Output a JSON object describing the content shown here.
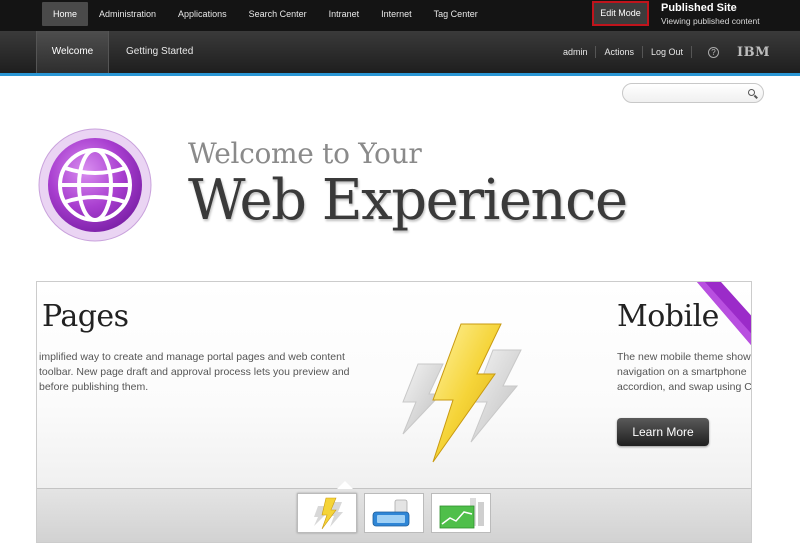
{
  "topnav": {
    "items": [
      "Home",
      "Administration",
      "Applications",
      "Search Center",
      "Intranet",
      "Internet",
      "Tag Center"
    ],
    "edit_mode": "Edit Mode",
    "published_title": "Published Site",
    "published_sub": "Viewing published content"
  },
  "subnav": {
    "welcome": "Welcome",
    "getting_started": "Getting Started",
    "user": "admin",
    "actions": "Actions",
    "logout": "Log Out",
    "help": "?",
    "ibm": "IBM"
  },
  "search": {
    "placeholder": ""
  },
  "hero": {
    "line1": "Welcome to Your",
    "line2": "Web Experience"
  },
  "carousel": {
    "pages_title": "Pages",
    "pages_desc_lines": [
      "implified way to create and manage portal pages and web content",
      "toolbar. New page draft and approval process lets you preview and",
      "before publishing them."
    ],
    "mobile_title": "Mobile",
    "mobile_desc_lines": [
      "The new mobile theme show",
      "navigation on a smartphone",
      "accordion, and swap using C"
    ],
    "learn_more": "Learn More"
  },
  "colors": {
    "accent_blue": "#2a96d4",
    "edit_mode_border": "#c0141c",
    "globe_purple": "#a93fd0",
    "bolt_yellow": "#f5d438"
  }
}
